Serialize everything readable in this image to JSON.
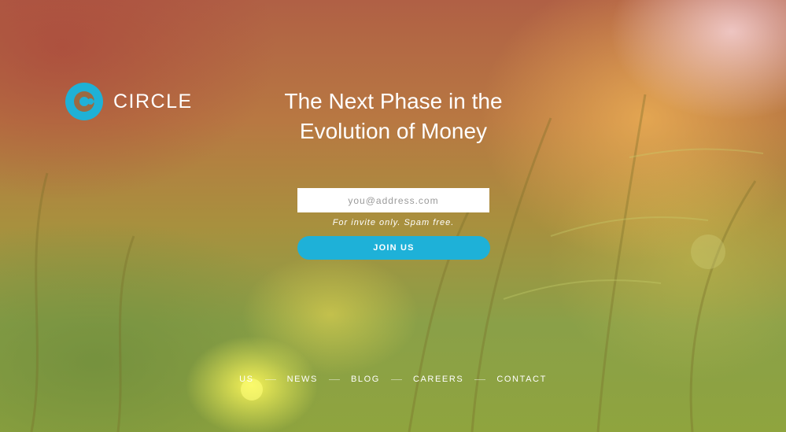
{
  "brand": {
    "logo_text": "CIRCLE",
    "accent_color": "#1fb1d6"
  },
  "hero": {
    "headline_line1": "The Next Phase in the",
    "headline_line2": "Evolution of Money"
  },
  "signup": {
    "email_placeholder": "you@address.com",
    "note": "For invite only. Spam free.",
    "join_label": "JOIN US"
  },
  "footer": {
    "links": [
      "US",
      "NEWS",
      "BLOG",
      "CAREERS",
      "CONTACT"
    ]
  }
}
